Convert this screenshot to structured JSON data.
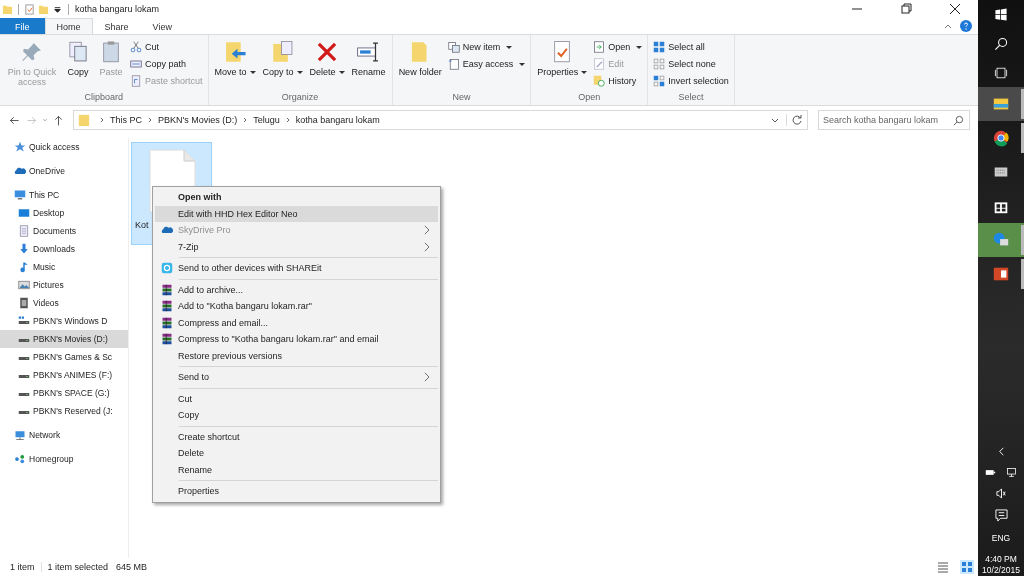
{
  "window": {
    "title": "kotha bangaru lokam"
  },
  "ribbon": {
    "tabs": [
      {
        "label": "File",
        "selected": false,
        "kind": "file"
      },
      {
        "label": "Home",
        "selected": true,
        "kind": "tab"
      },
      {
        "label": "Share",
        "selected": false,
        "kind": "tab"
      },
      {
        "label": "View",
        "selected": false,
        "kind": "tab"
      }
    ],
    "groups": [
      {
        "label": "Clipboard",
        "items": [
          {
            "label": "Pin to Quick access",
            "kind": "large",
            "disabled": true,
            "dropdown": false
          },
          {
            "label": "Copy",
            "kind": "large",
            "disabled": false,
            "dropdown": false
          },
          {
            "label": "Paste",
            "kind": "large",
            "disabled": true,
            "dropdown": false
          },
          {
            "label": "Cut",
            "kind": "small",
            "disabled": false,
            "dropdown": false
          },
          {
            "label": "Copy path",
            "kind": "small",
            "disabled": false,
            "dropdown": false
          },
          {
            "label": "Paste shortcut",
            "kind": "small",
            "disabled": true,
            "dropdown": false
          }
        ]
      },
      {
        "label": "Organize",
        "items": [
          {
            "label": "Move to",
            "kind": "large",
            "disabled": false,
            "dropdown": true
          },
          {
            "label": "Copy to",
            "kind": "large",
            "disabled": false,
            "dropdown": true
          },
          {
            "label": "Delete",
            "kind": "large",
            "disabled": false,
            "dropdown": true
          },
          {
            "label": "Rename",
            "kind": "large",
            "disabled": false,
            "dropdown": false
          }
        ]
      },
      {
        "label": "New",
        "items": [
          {
            "label": "New folder",
            "kind": "large",
            "disabled": false,
            "dropdown": false
          },
          {
            "label": "New item",
            "kind": "small",
            "disabled": false,
            "dropdown": true
          },
          {
            "label": "Easy access",
            "kind": "small",
            "disabled": false,
            "dropdown": true
          }
        ]
      },
      {
        "label": "Open",
        "items": [
          {
            "label": "Properties",
            "kind": "large",
            "disabled": false,
            "dropdown": true
          },
          {
            "label": "Open",
            "kind": "small",
            "disabled": false,
            "dropdown": true
          },
          {
            "label": "Edit",
            "kind": "small",
            "disabled": true,
            "dropdown": false
          },
          {
            "label": "History",
            "kind": "small",
            "disabled": false,
            "dropdown": false
          }
        ]
      },
      {
        "label": "Select",
        "items": [
          {
            "label": "Select all",
            "kind": "small",
            "disabled": false,
            "dropdown": false
          },
          {
            "label": "Select none",
            "kind": "small",
            "disabled": false,
            "dropdown": false
          },
          {
            "label": "Invert selection",
            "kind": "small",
            "disabled": false,
            "dropdown": false
          }
        ]
      }
    ]
  },
  "address_bar": {
    "path": [
      "This PC",
      "PBKN's Movies (D:)",
      "Telugu",
      "kotha bangaru lokam"
    ],
    "search": {
      "placeholder": "Search kotha bangaru lokam"
    }
  },
  "sidebar": {
    "items": [
      {
        "label": "Quick access",
        "selected": false
      },
      {
        "label": "OneDrive",
        "selected": false
      },
      {
        "label": "This PC",
        "selected": false,
        "children": [
          {
            "label": "Desktop",
            "selected": false
          },
          {
            "label": "Documents",
            "selected": false
          },
          {
            "label": "Downloads",
            "selected": false
          },
          {
            "label": "Music",
            "selected": false
          },
          {
            "label": "Pictures",
            "selected": false
          },
          {
            "label": "Videos",
            "selected": false
          },
          {
            "label": "PBKN's Windows D",
            "selected": false
          },
          {
            "label": "PBKN's Movies (D:)",
            "selected": true
          },
          {
            "label": "PBKN's Games & Sc",
            "selected": false
          },
          {
            "label": "PBKN's ANIMES (F:)",
            "selected": false
          },
          {
            "label": "PBKN's SPACE (G:)",
            "selected": false
          },
          {
            "label": "PBKN's Reserved (J:",
            "selected": false
          }
        ]
      },
      {
        "label": "Network",
        "selected": false
      },
      {
        "label": "Homegroup",
        "selected": false
      }
    ]
  },
  "files": [
    {
      "label": "Kot",
      "selected": true
    }
  ],
  "context_menu": {
    "sections": [
      [
        {
          "label": "Open with",
          "default": true,
          "selected": false,
          "disabled": false,
          "submenu": false
        },
        {
          "label": "Edit with HHD Hex Editor Neo",
          "default": false,
          "selected": true,
          "disabled": false,
          "submenu": false
        },
        {
          "label": "SkyDrive Pro",
          "default": false,
          "selected": false,
          "disabled": true,
          "submenu": true
        },
        {
          "label": "7-Zip",
          "default": false,
          "selected": false,
          "disabled": false,
          "submenu": true
        }
      ],
      [
        {
          "label": "Send to other devices with SHAREit",
          "default": false,
          "selected": false,
          "disabled": false,
          "submenu": false
        }
      ],
      [
        {
          "label": "Add to archive...",
          "default": false,
          "selected": false,
          "disabled": false,
          "submenu": false
        },
        {
          "label": "Add to \"Kotha bangaru lokam.rar\"",
          "default": false,
          "selected": false,
          "disabled": false,
          "submenu": false
        },
        {
          "label": "Compress and email...",
          "default": false,
          "selected": false,
          "disabled": false,
          "submenu": false
        },
        {
          "label": "Compress to \"Kotha bangaru lokam.rar\" and email",
          "default": false,
          "selected": false,
          "disabled": false,
          "submenu": false
        },
        {
          "label": "Restore previous versions",
          "default": false,
          "selected": false,
          "disabled": false,
          "submenu": false
        }
      ],
      [
        {
          "label": "Send to",
          "default": false,
          "selected": false,
          "disabled": false,
          "submenu": true
        }
      ],
      [
        {
          "label": "Cut",
          "default": false,
          "selected": false,
          "disabled": false,
          "submenu": false
        },
        {
          "label": "Copy",
          "default": false,
          "selected": false,
          "disabled": false,
          "submenu": false
        }
      ],
      [
        {
          "label": "Create shortcut",
          "default": false,
          "selected": false,
          "disabled": false,
          "submenu": false
        },
        {
          "label": "Delete",
          "default": false,
          "selected": false,
          "disabled": false,
          "submenu": false
        },
        {
          "label": "Rename",
          "default": false,
          "selected": false,
          "disabled": false,
          "submenu": false
        }
      ],
      [
        {
          "label": "Properties",
          "default": false,
          "selected": false,
          "disabled": false,
          "submenu": false
        }
      ]
    ]
  },
  "status_bar": {
    "count": "1 item",
    "selection": "1 item selected",
    "size": "645 MB"
  },
  "taskbar": {
    "apps": [
      {
        "running": true,
        "active": true,
        "flashing": false
      },
      {
        "running": true,
        "active": false,
        "flashing": false
      },
      {
        "running": false,
        "active": false,
        "flashing": false
      },
      {
        "running": false,
        "active": false,
        "flashing": false
      },
      {
        "running": true,
        "active": false,
        "flashing": true
      },
      {
        "running": true,
        "active": false,
        "flashing": false
      }
    ],
    "language": "ENG",
    "time": "4:40 PM",
    "date": "10/2/2015"
  }
}
